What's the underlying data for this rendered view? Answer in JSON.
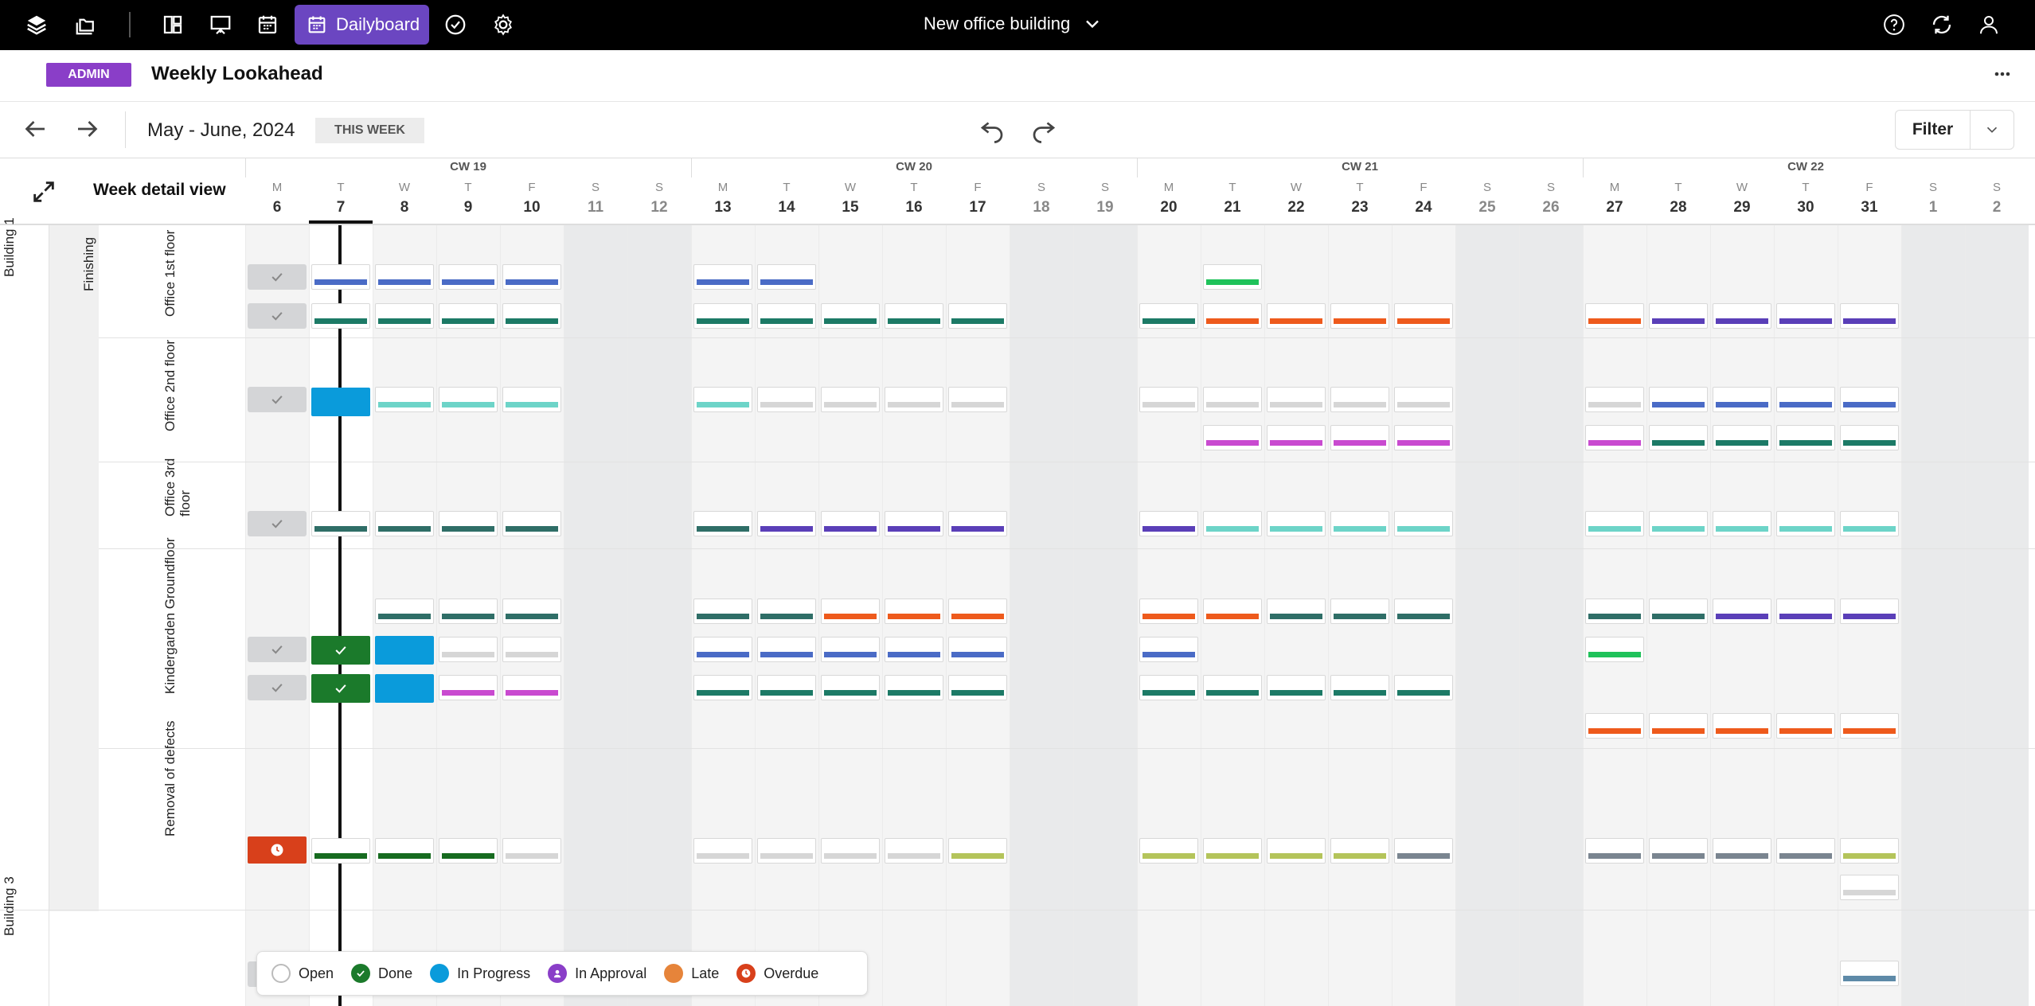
{
  "topbar": {
    "project_title": "New office building",
    "daily_button_label": "Dailyboard",
    "icons": [
      "layers-icon",
      "folders-icon",
      "layout-icon",
      "presentation-icon",
      "calendar-icon",
      "checklist-icon",
      "settings-icon",
      "help-icon",
      "sync-icon",
      "user-icon"
    ]
  },
  "header": {
    "role_badge": "ADMIN",
    "title": "Weekly Lookahead",
    "date_range": "May - June, 2024",
    "this_week_label": "THIS WEEK",
    "filter_label": "Filter"
  },
  "grid": {
    "view_label": "Week detail view",
    "calendar_weeks": [
      "CW 19",
      "CW 20",
      "CW 21",
      "CW 22"
    ],
    "days": [
      {
        "letter": "M",
        "num": "6"
      },
      {
        "letter": "T",
        "num": "7"
      },
      {
        "letter": "W",
        "num": "8"
      },
      {
        "letter": "T",
        "num": "9"
      },
      {
        "letter": "F",
        "num": "10"
      },
      {
        "letter": "S",
        "num": "11"
      },
      {
        "letter": "S",
        "num": "12"
      },
      {
        "letter": "M",
        "num": "13"
      },
      {
        "letter": "T",
        "num": "14"
      },
      {
        "letter": "W",
        "num": "15"
      },
      {
        "letter": "T",
        "num": "16"
      },
      {
        "letter": "F",
        "num": "17"
      },
      {
        "letter": "S",
        "num": "18"
      },
      {
        "letter": "S",
        "num": "19"
      },
      {
        "letter": "M",
        "num": "20"
      },
      {
        "letter": "T",
        "num": "21"
      },
      {
        "letter": "W",
        "num": "22"
      },
      {
        "letter": "T",
        "num": "23"
      },
      {
        "letter": "F",
        "num": "24"
      },
      {
        "letter": "S",
        "num": "25"
      },
      {
        "letter": "S",
        "num": "26"
      },
      {
        "letter": "M",
        "num": "27"
      },
      {
        "letter": "T",
        "num": "28"
      },
      {
        "letter": "W",
        "num": "29"
      },
      {
        "letter": "T",
        "num": "30"
      },
      {
        "letter": "F",
        "num": "31"
      },
      {
        "letter": "S",
        "num": "1"
      },
      {
        "letter": "S",
        "num": "2"
      }
    ],
    "buildings": [
      "Building 1",
      "Building 3"
    ],
    "phase": "Finishing",
    "areas": [
      "Office 1st floor",
      "Office 2nd floor",
      "Office 3rd floor",
      "Kindergarden Groundfloor",
      "Removal of defects"
    ]
  },
  "legend": [
    {
      "label": "Open",
      "color": "#ffffff"
    },
    {
      "label": "Done",
      "color": "#1b7a2b"
    },
    {
      "label": "In Progress",
      "color": "#0a9bdb"
    },
    {
      "label": "In Approval",
      "color": "#8a3ec8"
    },
    {
      "label": "Late",
      "color": "#e6843a"
    },
    {
      "label": "Overdue",
      "color": "#d8401b"
    }
  ],
  "colors": {
    "blue": "#4a6bc6",
    "teal": "#1c7a66",
    "dteal": "#2f6e67",
    "orange": "#ee5a1c",
    "purple": "#5a3fb8",
    "green": "#1fc25a",
    "cyan": "#6dd4c8",
    "grey": "#d6d6d6",
    "magenta": "#c94ad0",
    "dgreen": "#166b1f",
    "lime": "#b4c45a",
    "slate": "#7a8590",
    "steel": "#5e8aa8"
  }
}
